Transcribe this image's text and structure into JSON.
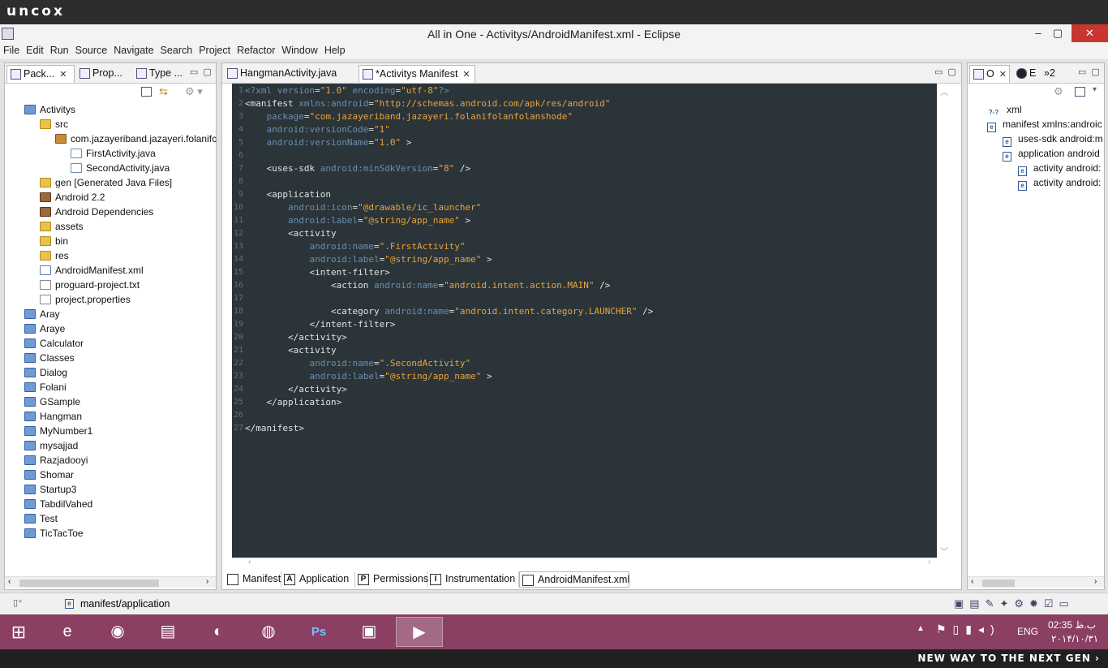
{
  "banner": {
    "logo": "uncox",
    "footer": "NEW WAY TO THE NEXT GEN ›"
  },
  "window": {
    "title": "All in One - Activitys/AndroidManifest.xml - Eclipse",
    "minimize": "–",
    "maximize": "▢",
    "close": "✕"
  },
  "menu": [
    "File",
    "Edit",
    "Run",
    "Source",
    "Navigate",
    "Search",
    "Project",
    "Refactor",
    "Window",
    "Help"
  ],
  "left_panel": {
    "tabs": [
      "Pack...",
      "Prop...",
      "Type ..."
    ],
    "tree": [
      {
        "label": "Activitys",
        "icon": "project-open-icon",
        "depth": 0
      },
      {
        "label": "src",
        "icon": "folder-icon",
        "depth": 1
      },
      {
        "label": "com.jazayeriband.jazayeri.folanifc",
        "icon": "package-icon",
        "depth": 2
      },
      {
        "label": "FirstActivity.java",
        "icon": "java-file-icon",
        "depth": 3
      },
      {
        "label": "SecondActivity.java",
        "icon": "java-file-icon",
        "depth": 3
      },
      {
        "label": "gen [Generated Java Files]",
        "icon": "folder-icon",
        "depth": 1
      },
      {
        "label": "Android 2.2",
        "icon": "library-icon",
        "depth": 1
      },
      {
        "label": "Android Dependencies",
        "icon": "library-icon",
        "depth": 1
      },
      {
        "label": "assets",
        "icon": "folder-icon",
        "depth": 1
      },
      {
        "label": "bin",
        "icon": "folder-icon",
        "depth": 1
      },
      {
        "label": "res",
        "icon": "folder-icon",
        "depth": 1
      },
      {
        "label": "AndroidManifest.xml",
        "icon": "xml-file-icon",
        "depth": 1
      },
      {
        "label": "proguard-project.txt",
        "icon": "text-file-icon",
        "depth": 1
      },
      {
        "label": "project.properties",
        "icon": "text-file-icon",
        "depth": 1
      },
      {
        "label": "Aray",
        "icon": "project-icon",
        "depth": 0
      },
      {
        "label": "Araye",
        "icon": "project-icon",
        "depth": 0
      },
      {
        "label": "Calculator",
        "icon": "project-icon",
        "depth": 0
      },
      {
        "label": "Classes",
        "icon": "project-icon",
        "depth": 0
      },
      {
        "label": "Dialog",
        "icon": "project-icon",
        "depth": 0
      },
      {
        "label": "Folani",
        "icon": "project-icon",
        "depth": 0
      },
      {
        "label": "GSample",
        "icon": "project-icon",
        "depth": 0
      },
      {
        "label": "Hangman",
        "icon": "project-open-icon",
        "depth": 0
      },
      {
        "label": "MyNumber1",
        "icon": "project-icon",
        "depth": 0
      },
      {
        "label": "mysajjad",
        "icon": "project-icon",
        "depth": 0
      },
      {
        "label": "Razjadooyi",
        "icon": "project-icon",
        "depth": 0
      },
      {
        "label": "Shomar",
        "icon": "project-icon",
        "depth": 0
      },
      {
        "label": "Startup3",
        "icon": "project-icon",
        "depth": 0
      },
      {
        "label": "TabdilVahed",
        "icon": "project-icon",
        "depth": 0
      },
      {
        "label": "Test",
        "icon": "project-icon",
        "depth": 0
      },
      {
        "label": "TicTacToe",
        "icon": "project-icon",
        "depth": 0
      }
    ]
  },
  "editor": {
    "tabs": [
      "HangmanActivity.java",
      "*Activitys Manifest"
    ],
    "lines": [
      [
        [
          "pi",
          "<?xml "
        ],
        [
          "attr",
          "version"
        ],
        [
          "tag",
          "="
        ],
        [
          "val",
          "\"1.0\""
        ],
        [
          "attr",
          " encoding"
        ],
        [
          "tag",
          "="
        ],
        [
          "val",
          "\"utf-8\""
        ],
        [
          "pi",
          "?>"
        ]
      ],
      [
        [
          "tag",
          "<manifest "
        ],
        [
          "attr",
          "xmlns:android"
        ],
        [
          "tag",
          "="
        ],
        [
          "val",
          "\"http://schemas.android.com/apk/res/android\""
        ]
      ],
      [
        [
          "tag",
          "    "
        ],
        [
          "attr",
          "package"
        ],
        [
          "tag",
          "="
        ],
        [
          "val",
          "\"com.jazayeriband.jazayeri.folanifolanfolanshode\""
        ]
      ],
      [
        [
          "tag",
          "    "
        ],
        [
          "attr",
          "android:versionCode"
        ],
        [
          "tag",
          "="
        ],
        [
          "val",
          "\"1\""
        ]
      ],
      [
        [
          "tag",
          "    "
        ],
        [
          "attr",
          "android:versionName"
        ],
        [
          "tag",
          "="
        ],
        [
          "val",
          "\"1.0\""
        ],
        [
          "tag",
          " >"
        ]
      ],
      [],
      [
        [
          "tag",
          "    <uses-sdk "
        ],
        [
          "attr",
          "android:minSdkVersion"
        ],
        [
          "tag",
          "="
        ],
        [
          "val",
          "\"8\""
        ],
        [
          "tag",
          " />"
        ]
      ],
      [],
      [
        [
          "tag",
          "    <application"
        ]
      ],
      [
        [
          "tag",
          "        "
        ],
        [
          "attr",
          "android:icon"
        ],
        [
          "tag",
          "="
        ],
        [
          "val",
          "\"@drawable/ic_launcher\""
        ]
      ],
      [
        [
          "tag",
          "        "
        ],
        [
          "attr",
          "android:label"
        ],
        [
          "tag",
          "="
        ],
        [
          "val",
          "\"@string/app_name\""
        ],
        [
          "tag",
          " >"
        ]
      ],
      [
        [
          "tag",
          "        <activity"
        ]
      ],
      [
        [
          "tag",
          "            "
        ],
        [
          "attr",
          "android:name"
        ],
        [
          "tag",
          "="
        ],
        [
          "val",
          "\".FirstActivity\""
        ]
      ],
      [
        [
          "tag",
          "            "
        ],
        [
          "attr",
          "android:label"
        ],
        [
          "tag",
          "="
        ],
        [
          "val",
          "\"@string/app_name\""
        ],
        [
          "tag",
          " >"
        ]
      ],
      [
        [
          "tag",
          "            <intent-filter>"
        ]
      ],
      [
        [
          "tag",
          "                <action "
        ],
        [
          "attr",
          "android:name"
        ],
        [
          "tag",
          "="
        ],
        [
          "val",
          "\"android.intent.action.MAIN\""
        ],
        [
          "tag",
          " />"
        ]
      ],
      [],
      [
        [
          "tag",
          "                <category "
        ],
        [
          "attr",
          "android:name"
        ],
        [
          "tag",
          "="
        ],
        [
          "val",
          "\"android.intent.category.LAUNCHER\""
        ],
        [
          "tag",
          " />"
        ]
      ],
      [
        [
          "tag",
          "            </intent-filter>"
        ]
      ],
      [
        [
          "tag",
          "        </activity>"
        ]
      ],
      [
        [
          "tag",
          "        <activity"
        ]
      ],
      [
        [
          "tag",
          "            "
        ],
        [
          "attr",
          "android:name"
        ],
        [
          "tag",
          "="
        ],
        [
          "val",
          "\".SecondActivity\""
        ]
      ],
      [
        [
          "tag",
          "            "
        ],
        [
          "attr",
          "android:label"
        ],
        [
          "tag",
          "="
        ],
        [
          "val",
          "\"@string/app_name\""
        ],
        [
          "tag",
          " >"
        ]
      ],
      [
        [
          "tag",
          "        </activity>"
        ]
      ],
      [
        [
          "tag",
          "    </application>"
        ]
      ],
      [],
      [
        [
          "tag",
          "</manifest>"
        ]
      ]
    ],
    "bottom_tabs": [
      {
        "label": "Manifest",
        "icon": "manifest-tab-icon",
        "glyph": ""
      },
      {
        "label": "Application",
        "icon": "application-tab-icon",
        "glyph": "A"
      },
      {
        "label": "Permissions",
        "icon": "permissions-tab-icon",
        "glyph": "P"
      },
      {
        "label": "Instrumentation",
        "icon": "instrumentation-tab-icon",
        "glyph": "I"
      },
      {
        "label": "AndroidManifest.xml",
        "icon": "xml-tab-icon",
        "glyph": ""
      }
    ]
  },
  "outline": {
    "tabs": [
      "O",
      "E",
      "»2"
    ],
    "tree": [
      {
        "label": "xml",
        "glyph": "?-?",
        "depth": 0
      },
      {
        "label": "manifest xmlns:androic",
        "glyph": "e",
        "depth": 0
      },
      {
        "label": "uses-sdk android:m",
        "glyph": "e",
        "depth": 1
      },
      {
        "label": "application android",
        "glyph": "e",
        "depth": 1
      },
      {
        "label": "activity android:",
        "glyph": "e",
        "depth": 2
      },
      {
        "label": "activity android:",
        "glyph": "e",
        "depth": 2
      }
    ]
  },
  "status": {
    "path": "manifest/application"
  },
  "taskbar": {
    "apps": [
      "ie-icon",
      "chrome-icon",
      "explorer-icon",
      "eclipse-icon",
      "firefox-icon",
      "photoshop-icon",
      "window-icon",
      "media-player-icon"
    ],
    "lang": "ENG",
    "time": "02:35 ب.ظ",
    "date": "۲۰۱۴/۱۰/۳۱"
  }
}
